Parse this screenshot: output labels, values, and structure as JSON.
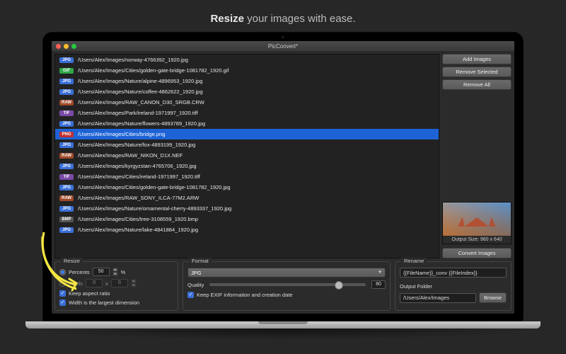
{
  "tagline": {
    "bold": "Resize",
    "rest": " your images with ease."
  },
  "window": {
    "title": "PicConvert*"
  },
  "files": [
    {
      "type": "JPG",
      "color": "#3a6fd8",
      "path": "/Users/Alex/Images/norway-4766392_1920.jpg"
    },
    {
      "type": "GIF",
      "color": "#2fa84a",
      "path": "/Users/Alex/Images/Cities/golden-gate-bridge-1081782_1920.gif"
    },
    {
      "type": "JPG",
      "color": "#3a6fd8",
      "path": "/Users/Alex/Images/Nature/alpine-4896953_1920.jpg"
    },
    {
      "type": "JPG",
      "color": "#3a6fd8",
      "path": "/Users/Alex/Images/Nature/coffee-4862622_1920.jpg"
    },
    {
      "type": "RAW",
      "color": "#a04a2a",
      "path": "/Users/Alex/Images/RAW_CANON_D30_SRGB.CRW"
    },
    {
      "type": "TIF",
      "color": "#7a4aa8",
      "path": "/Users/Alex/Images/Park/ireland-1971997_1920.tiff"
    },
    {
      "type": "JPG",
      "color": "#3a6fd8",
      "path": "/Users/Alex/Images/Nature/flowers-4893789_1920.jpg"
    },
    {
      "type": "PNG",
      "color": "#c22f2f",
      "path": "/Users/Alex/Images/Cities/bridge.png",
      "selected": true
    },
    {
      "type": "JPG",
      "color": "#3a6fd8",
      "path": "/Users/Alex/Images/Nature/fox-4893199_1920.jpg"
    },
    {
      "type": "RAW",
      "color": "#a04a2a",
      "path": "/Users/Alex/Images/RAW_NIKON_D1X.NEF"
    },
    {
      "type": "JPG",
      "color": "#3a6fd8",
      "path": "/Users/Alex/Images/kyrgyzstan-4765706_1920.jpg"
    },
    {
      "type": "TIF",
      "color": "#7a4aa8",
      "path": "/Users/Alex/Images/Cities/ireland-1971997_1920.tiff"
    },
    {
      "type": "JPG",
      "color": "#3a6fd8",
      "path": "/Users/Alex/Images/Cities/golden-gate-bridge-1081782_1920.jpg"
    },
    {
      "type": "RAW",
      "color": "#a04a2a",
      "path": "/Users/Alex/Images/RAW_SONY_ILCA-77M2.ARW"
    },
    {
      "type": "JPG",
      "color": "#3a6fd8",
      "path": "/Users/Alex/Images/Nature/ornamental-cherry-4893337_1920.jpg"
    },
    {
      "type": "BMP",
      "color": "#555555",
      "path": "/Users/Alex/Images/Cities/tree-3108559_1920.bmp"
    },
    {
      "type": "JPG",
      "color": "#3a6fd8",
      "path": "/Users/Alex/Images/Nature/lake-4841884_1920.jpg"
    }
  ],
  "buttons": {
    "add": "Add Images",
    "removeSel": "Remove Selected",
    "removeAll": "Remove All",
    "convert": "Convert Images",
    "browse": "Browse"
  },
  "preview": {
    "label": "Output Size: 960 x 640"
  },
  "resize": {
    "title": "Resize",
    "percents_label": "Percents",
    "percents_value": "50",
    "percents_unit": "%",
    "pixels_label": "Pixels",
    "pixels_w": "0",
    "pixels_sep": "x",
    "pixels_h": "0",
    "keep_ratio": "Keep aspect ratio",
    "width_largest": "Width is the largest dimension"
  },
  "format": {
    "title": "Format",
    "selected": "JPG",
    "quality_label": "Quality",
    "quality_value": "80",
    "keep_exif": "Keep EXIF information and creation date"
  },
  "rename": {
    "title": "Rename",
    "pattern": "{{FileName}}_conv {{FileIndex}}",
    "output_label": "Output Folder",
    "output_path": "/Users/Alex/Images"
  }
}
